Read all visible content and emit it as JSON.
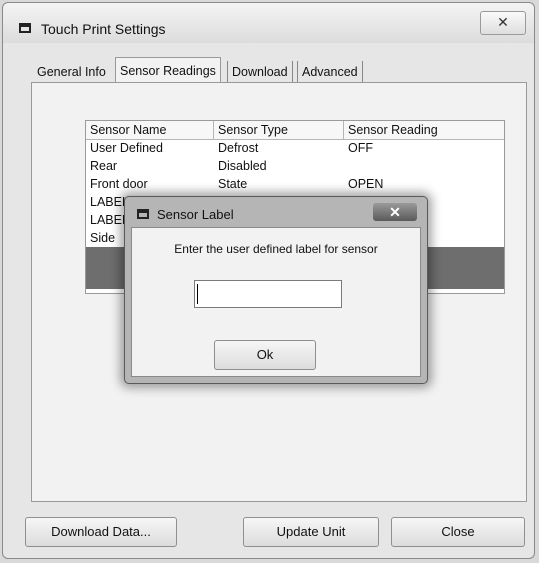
{
  "window": {
    "title": "Touch Print Settings",
    "close_glyph": "✕"
  },
  "tabs": [
    {
      "label": "General Info"
    },
    {
      "label": "Sensor Readings"
    },
    {
      "label": "Download"
    },
    {
      "label": "Advanced"
    }
  ],
  "sensor_table": {
    "columns": [
      "Sensor Name",
      "Sensor Type",
      "Sensor Reading"
    ],
    "rows": [
      [
        "User Defined",
        "Defrost",
        "OFF"
      ],
      [
        "Rear",
        "Disabled",
        ""
      ],
      [
        "Front door",
        "State",
        "OPEN"
      ],
      [
        "LABEL",
        "",
        ""
      ],
      [
        "LABEL",
        "",
        ""
      ],
      [
        "Side",
        "",
        ""
      ]
    ]
  },
  "buttons": {
    "download": "Download Data...",
    "update": "Update Unit",
    "close": "Close"
  },
  "dialog": {
    "title": "Sensor Label",
    "close_glyph": "✕",
    "prompt": "Enter the user defined label for sensor",
    "input_value": "",
    "ok": "Ok"
  }
}
